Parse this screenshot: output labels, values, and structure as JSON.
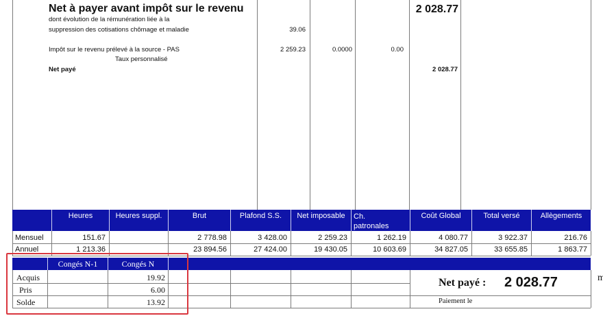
{
  "upper": {
    "title": "Net à payer avant impôt sur le revenu",
    "title_amount": "2 028.77",
    "evolution_line1": "dont évolution de la rémunération liée à la",
    "evolution_line2": "suppression des cotisations chômage et maladie",
    "evolution_amount": "39.06",
    "pas_label": "Impôt sur le revenu prélevé à la source - PAS",
    "pas_sub": "Taux personnalisé",
    "pas_base": "2 259.23",
    "pas_rate": "0.0000",
    "pas_amount": "0.00",
    "net_paye_label": "Net payé",
    "net_paye_amount": "2 028.77"
  },
  "summary": {
    "headers": [
      "Heures",
      "Heures suppl.",
      "Brut",
      "Plafond S.S.",
      "Net imposable",
      "Ch. patronales",
      "Coût Global",
      "Total versé",
      "Allègements"
    ],
    "rows": [
      {
        "label": "Mensuel",
        "values": [
          "151.67",
          "",
          "2 778.98",
          "3 428.00",
          "2 259.23",
          "1 262.19",
          "4 080.77",
          "3 922.37",
          "216.76"
        ]
      },
      {
        "label": "Annuel",
        "values": [
          "1 213.36",
          "",
          "23 894.56",
          "27 424.00",
          "19 430.05",
          "10 603.69",
          "34 827.05",
          "33 655.85",
          "1 863.77"
        ]
      }
    ]
  },
  "conges": {
    "headers": [
      "Congés N-1",
      "Congés N"
    ],
    "rows": [
      {
        "label": "Acquis",
        "n1": "",
        "n": "19.92"
      },
      {
        "label": "Pris",
        "n1": "",
        "n": "6.00"
      },
      {
        "label": "Solde",
        "n1": "",
        "n": "13.92"
      }
    ]
  },
  "net_box": {
    "label": "Net payé :",
    "amount": "2 028.77",
    "paiement_label": "Paiement le",
    "cut_char": "m"
  },
  "colors": {
    "header_blue": "#0f14a8",
    "highlight_red": "#d9363e"
  }
}
